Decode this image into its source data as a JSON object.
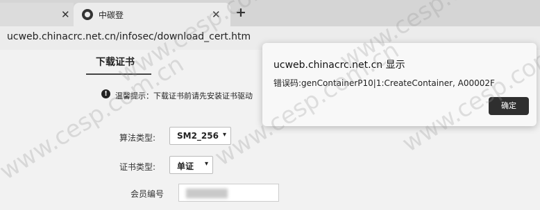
{
  "browser": {
    "tab_close_glyph": "✕",
    "active_tab": {
      "title": "中碳登",
      "close_glyph": "✕"
    },
    "new_tab_glyph": "+",
    "url": "ucweb.chinacrc.net.cn/infosec/download_cert.htm"
  },
  "page": {
    "tab_label": "下载证书",
    "tip_icon": "!",
    "tip": "温馨提示：下载证书前请先安装证书驱动",
    "fields": {
      "algorithm": {
        "label": "算法类型:",
        "value": "SM2_256",
        "chevron": "▾"
      },
      "cert_type": {
        "label": "证书类型:",
        "value": "单证",
        "chevron": "▾"
      },
      "member_no": {
        "label": "会员编号"
      }
    }
  },
  "dialog": {
    "title": "ucweb.chinacrc.net.cn 显示",
    "message": "错误码:genContainerP10|1:CreateContainer, A00002F",
    "ok_label": "确定"
  },
  "watermark": {
    "text": "www.cesp.com.cn"
  }
}
